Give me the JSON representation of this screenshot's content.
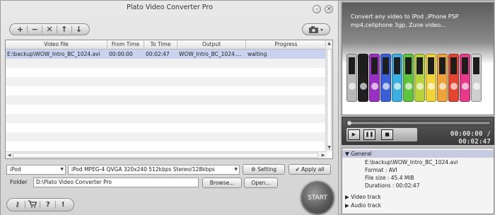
{
  "app": {
    "title": "Plato Video Converter Pro",
    "window": {
      "minimize": "–",
      "close": "✕"
    }
  },
  "toolbar": {
    "buttons": [
      {
        "name": "add",
        "glyph": "+"
      },
      {
        "name": "remove",
        "glyph": "−"
      },
      {
        "name": "clear",
        "glyph": "✕"
      },
      {
        "name": "move-up",
        "glyph": "↑"
      },
      {
        "name": "move-down",
        "glyph": "↓"
      }
    ]
  },
  "table": {
    "columns": [
      "Video file",
      "From Time",
      "To Time",
      "Output",
      "Progress"
    ],
    "rows": [
      {
        "file": "E:\\backup\\WOW_Intro_BC_1024.avi",
        "from": "00:00:00",
        "to": "00:02:47",
        "output": "WOW_Intro_BC_1024....",
        "progress": "waiting"
      }
    ]
  },
  "conversion": {
    "device": "iPod",
    "profile": "iPod  MPEG-4 QVGA 320x240 512kbps  Stereo/128kbps",
    "setting_label": "Setting",
    "apply_all_label": "Apply all",
    "folder_label": "Folder",
    "folder_value": "D:\\Plato Video Converter Pro",
    "browse_label": "Browse...",
    "open_label": "Open...",
    "start_label": "START"
  },
  "bottombar": {
    "icons": [
      {
        "name": "key-icon",
        "glyph": "🔑"
      },
      {
        "name": "cart-icon",
        "glyph": "🛒"
      },
      {
        "name": "help-icon",
        "glyph": "?"
      },
      {
        "name": "info-icon",
        "glyph": "!"
      }
    ]
  },
  "promo": {
    "text": "Convert any video to iPod ,iPhone PSP mp4,cellphone 3gp, Zune video...",
    "ipod_colors": [
      "#b8b8b8",
      "#202020",
      "#9a2fc4",
      "#3a5fd6",
      "#3bb0e0",
      "#5ec43c",
      "#b7d23a",
      "#f0d43a",
      "#f0a23a",
      "#e4452f",
      "#e83a8a",
      "#cfcfcf"
    ]
  },
  "player": {
    "play": "▶",
    "pause": "❚❚",
    "stop": "■",
    "timecode": "00:00:00 / 00:02:47"
  },
  "info": {
    "general_label": "General",
    "file": "E:\\backup\\WOW_Intro_BC_1024.avi",
    "format": "Format : AVI",
    "size": "File size : 45.4 MiB",
    "duration": "Durations : 00:02:47",
    "video_label": "Video track",
    "audio_label": "Audio track"
  }
}
